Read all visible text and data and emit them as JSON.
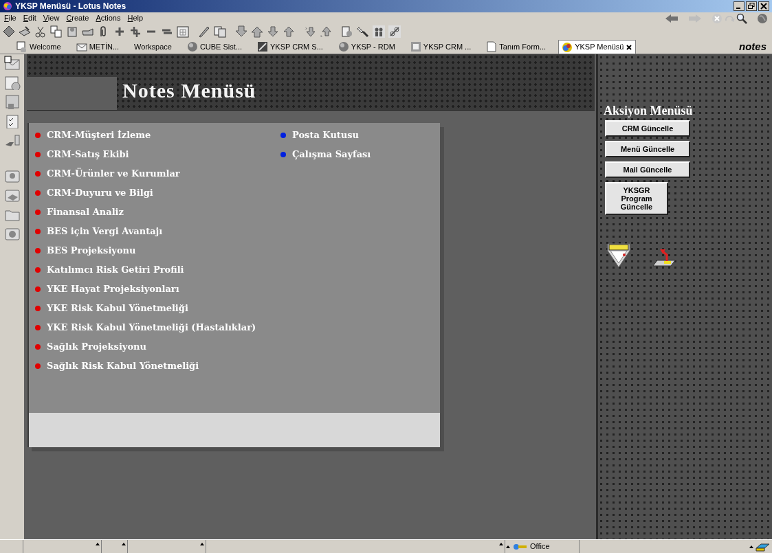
{
  "window": {
    "title": "YKSP Menüsü - Lotus Notes"
  },
  "menu_bar": [
    "File",
    "Edit",
    "View",
    "Create",
    "Actions",
    "Help"
  ],
  "tabs": [
    {
      "label": "Welcome",
      "selected": false
    },
    {
      "label": "METİN...",
      "selected": false
    },
    {
      "label": "Workspace",
      "selected": false
    },
    {
      "label": "CUBE Sist...",
      "selected": false
    },
    {
      "label": "YKSP CRM S...",
      "selected": false
    },
    {
      "label": "YKSP - RDM",
      "selected": false
    },
    {
      "label": "YKSP CRM ...",
      "selected": false
    },
    {
      "label": "Tanım Form...",
      "selected": false
    },
    {
      "label": "YKSP Menüsü",
      "selected": true
    }
  ],
  "logo": "notes",
  "page": {
    "title": "Notes Menüsü",
    "items": [
      {
        "label": "CRM-Müşteri İzleme",
        "color": "#e00000"
      },
      {
        "label": "CRM-Satış Ekibi",
        "color": "#e00000"
      },
      {
        "label": "CRM-Ürünler ve Kurumlar",
        "color": "#e00000"
      },
      {
        "label": "CRM-Duyuru ve Bilgi",
        "color": "#e00000"
      },
      {
        "label": "Finansal Analiz",
        "color": "#e00000"
      },
      {
        "label": "BES için Vergi Avantajı",
        "color": "#e00000"
      },
      {
        "label": "BES Projeksiyonu",
        "color": "#e00000"
      },
      {
        "label": "Katılımcı Risk Getiri Profili",
        "color": "#e00000"
      },
      {
        "label": "YKE Hayat Projeksiyonları",
        "color": "#e00000"
      },
      {
        "label": "YKE Risk Kabul Yönetmeliği",
        "color": "#e00000"
      },
      {
        "label": "YKE Risk Kabul Yönetmeliği (Hastalıklar)",
        "color": "#e00000"
      },
      {
        "label": "Sağlık Projeksiyonu",
        "color": "#e00000"
      },
      {
        "label": "Sağlık Risk Kabul Yönetmeliği",
        "color": "#e00000"
      }
    ],
    "side_links": [
      {
        "label": "Posta Kutusu",
        "color": "#0020e0"
      },
      {
        "label": "Çalışma Sayfası",
        "color": "#0020e0"
      }
    ]
  },
  "action_panel": {
    "title": "Aksiyon Menüsü",
    "buttons": [
      "CRM Güncelle",
      "Menü Güncelle",
      "Mail Güncelle",
      "YKSGR Program Güncelle"
    ]
  },
  "status_bar": {
    "location": "Office"
  }
}
